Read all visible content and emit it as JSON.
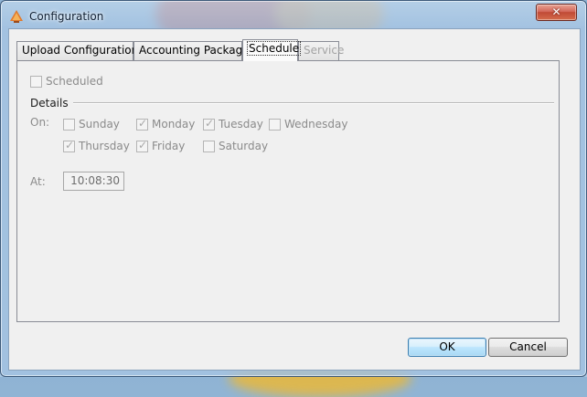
{
  "window": {
    "title": "Configuration",
    "close_glyph": "✕"
  },
  "tabs": [
    {
      "label": "Upload Configuration",
      "state": "normal"
    },
    {
      "label": "Accounting Package",
      "state": "normal"
    },
    {
      "label": "Schedule",
      "state": "active"
    },
    {
      "label": "Service",
      "state": "disabled"
    }
  ],
  "schedule": {
    "scheduled": {
      "label": "Scheduled",
      "checked": false
    },
    "details_label": "Details",
    "on_label": "On:",
    "days": [
      {
        "label": "Sunday",
        "checked": false
      },
      {
        "label": "Monday",
        "checked": true
      },
      {
        "label": "Tuesday",
        "checked": true
      },
      {
        "label": "Wednesday",
        "checked": false
      },
      {
        "label": "Thursday",
        "checked": true
      },
      {
        "label": "Friday",
        "checked": true
      },
      {
        "label": "Saturday",
        "checked": false
      }
    ],
    "at_label": "At:",
    "time_value": "10:08:30"
  },
  "buttons": {
    "ok_label": "OK",
    "cancel_label": "Cancel"
  },
  "icons": {
    "app": "app-logo-icon",
    "check": "✓"
  },
  "colors": {
    "disabled_text": "#8b8b8b",
    "default_button_border": "#3c7fb1",
    "close_button": "#c04a36"
  }
}
